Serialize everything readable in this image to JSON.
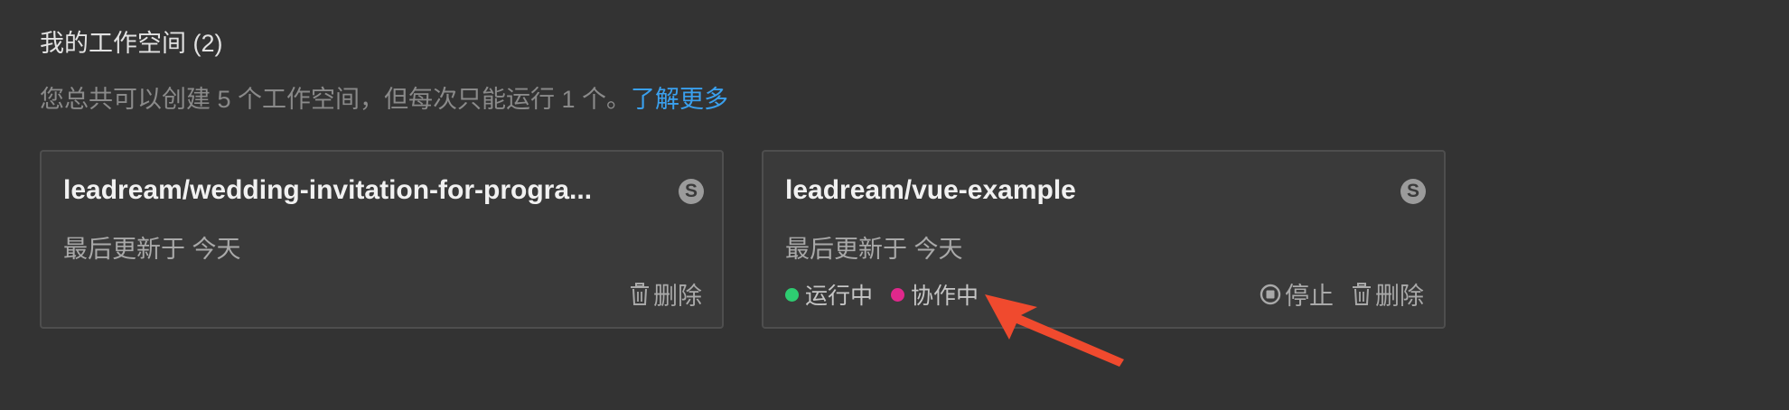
{
  "section": {
    "title": "我的工作空间 (2)",
    "description": "您总共可以创建 5 个工作空间，但每次只能运行 1 个。",
    "learn_more": "了解更多"
  },
  "workspaces": [
    {
      "name": "leadream/wedding-invitation-for-progra...",
      "badge": "S",
      "updated": "最后更新于 今天",
      "statuses": [],
      "actions": {
        "delete": "删除"
      }
    },
    {
      "name": "leadream/vue-example",
      "badge": "S",
      "updated": "最后更新于 今天",
      "statuses": [
        {
          "label": "运行中",
          "color": "#2ecc71"
        },
        {
          "label": "协作中",
          "color": "#e0288c"
        }
      ],
      "actions": {
        "stop": "停止",
        "delete": "删除"
      }
    }
  ],
  "colors": {
    "background": "#333333",
    "card_background": "#3a3a3a",
    "link": "#3aa0ee",
    "annotation_arrow": "#f04a2e"
  },
  "icons": {
    "badge": "s-badge-icon",
    "delete": "trash-icon",
    "stop": "stop-circle-icon",
    "annotation": "red-arrow-annotation"
  }
}
